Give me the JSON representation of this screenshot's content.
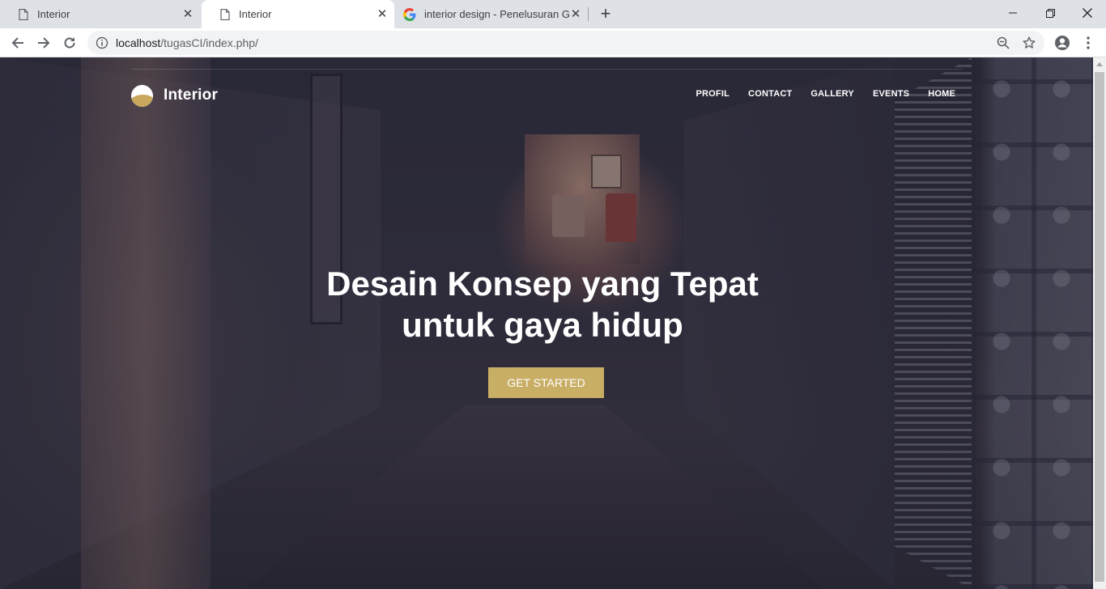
{
  "tabs": [
    {
      "label": "Interior",
      "icon": "page-icon"
    },
    {
      "label": "Interior",
      "icon": "page-icon"
    },
    {
      "label": "interior design - Penelusuran Goo",
      "icon": "google-icon"
    }
  ],
  "toolbar": {
    "url_host": "localhost",
    "url_path": "/tugasCI/index.php/"
  },
  "site": {
    "brand": "Interior",
    "nav": [
      "PROFIL",
      "CONTACT",
      "GALLERY",
      "EVENTS",
      "HOME"
    ],
    "hero_line1": "Desain Konsep yang Tepat",
    "hero_line2": "untuk gaya hidup",
    "cta": "GET STARTED"
  },
  "colors": {
    "accent": "#c9ae66",
    "tabstrip": "#dee1e6"
  }
}
